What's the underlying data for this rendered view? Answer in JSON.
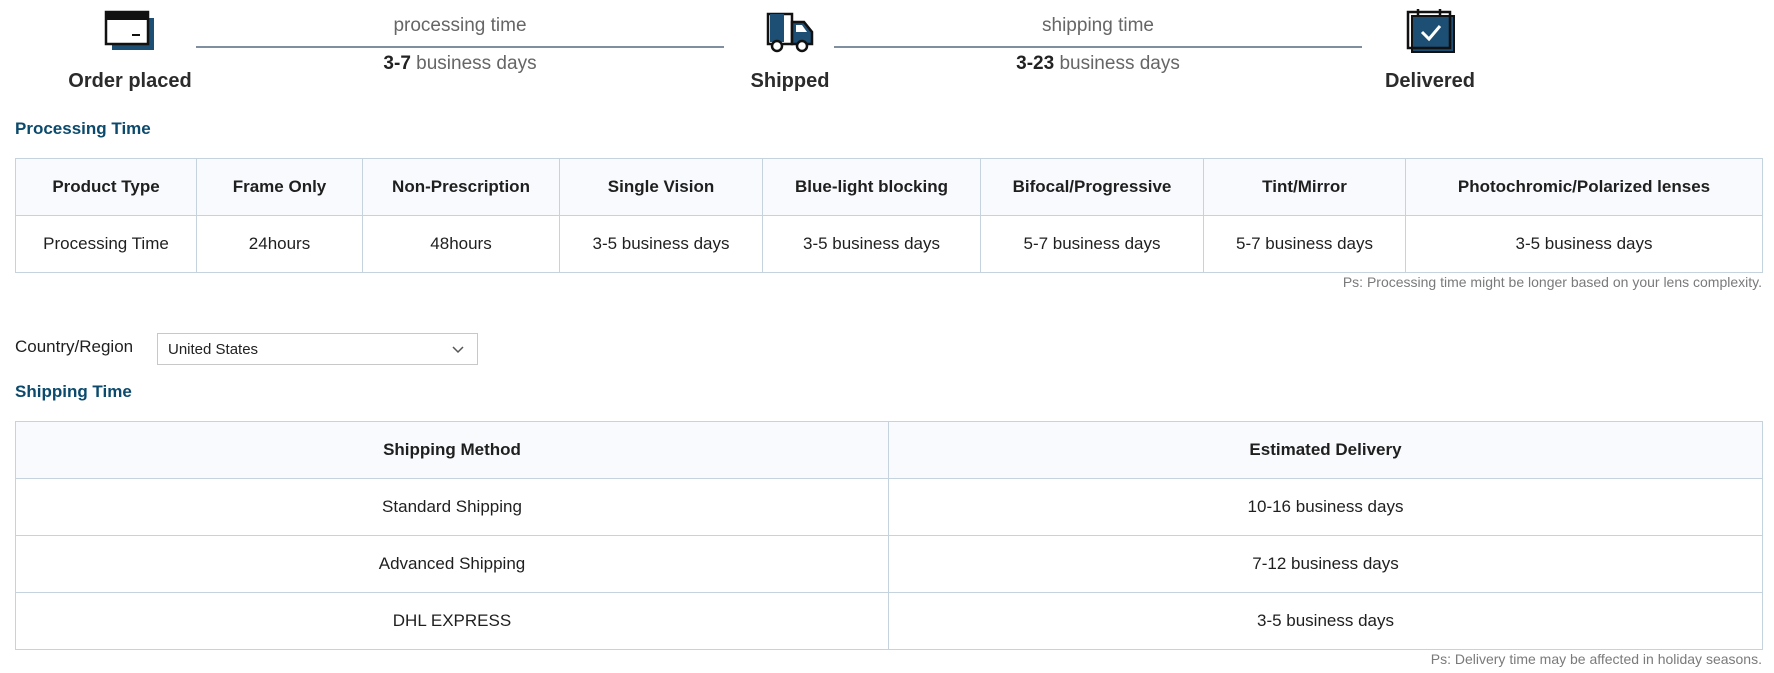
{
  "timeline": {
    "steps": [
      {
        "label": "Order placed",
        "icon": "credit-card-icon"
      },
      {
        "label": "Shipped",
        "icon": "truck-icon"
      },
      {
        "label": "Delivered",
        "icon": "calendar-check-icon"
      }
    ],
    "legs": [
      {
        "title": "processing time",
        "range": "3-7",
        "unit": " business days"
      },
      {
        "title": "shipping time",
        "range": "3-23",
        "unit": " business days"
      }
    ]
  },
  "processing": {
    "title": "Processing Time",
    "headers": [
      "Product Type",
      "Frame Only",
      "Non-Prescription",
      "Single Vision",
      "Blue-light blocking",
      "Bifocal/Progressive",
      "Tint/Mirror",
      "Photochromic/Polarized lenses"
    ],
    "row": [
      "Processing Time",
      "24hours",
      "48hours",
      "3-5 business days",
      "3-5 business days",
      "5-7 business days",
      "5-7 business days",
      "3-5 business days"
    ],
    "note": "Ps: Processing time might be longer based on your lens complexity."
  },
  "country": {
    "label": "Country/Region",
    "selected": "United States"
  },
  "shipping": {
    "title": "Shipping Time",
    "headers": [
      "Shipping Method",
      "Estimated Delivery"
    ],
    "rows": [
      [
        "Standard Shipping",
        "10-16 business days"
      ],
      [
        "Advanced Shipping",
        "7-12 business days"
      ],
      [
        "DHL EXPRESS",
        "3-5 business days"
      ]
    ],
    "note": "Ps: Delivery time may be affected in holiday seasons."
  },
  "colors": {
    "brand_dark": "#0b4a6c",
    "icon_navy": "#1d4e73",
    "border": "#c5d3df"
  }
}
